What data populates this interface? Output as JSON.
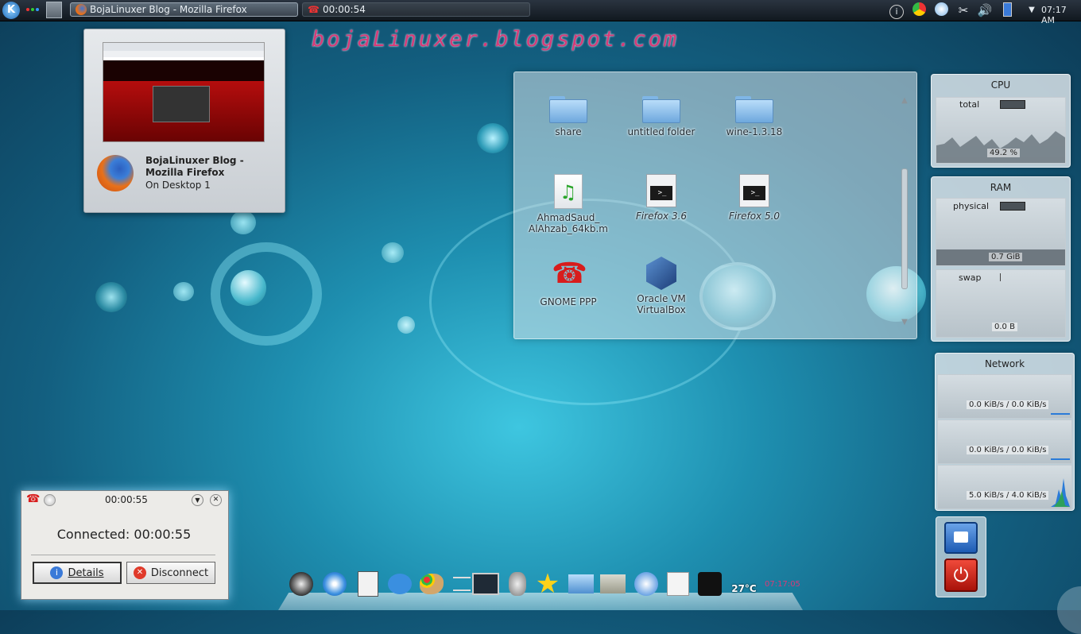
{
  "watermark": "bojaLinuxer.blogspot.com",
  "top_panel": {
    "tasks": [
      {
        "label": "BojaLinuxer Blog - Mozilla Firefox",
        "icon": "firefox-icon"
      },
      {
        "label": "00:00:54",
        "icon": "phone-icon"
      }
    ],
    "clock": "07:17 AM"
  },
  "task_preview": {
    "title": "BojaLinuxer Blog - Mozilla Firefox",
    "subtitle": "On Desktop 1"
  },
  "folder_view": {
    "items": [
      {
        "label": "share",
        "type": "folder"
      },
      {
        "label": "untitled folder",
        "type": "folder"
      },
      {
        "label": "wine-1.3.18",
        "type": "folder"
      },
      {
        "label": "AhmadSaud_ AlAhzab_64kb.m",
        "type": "audio"
      },
      {
        "label": "Firefox 3.6",
        "type": "launcher"
      },
      {
        "label": "Firefox 5.0",
        "type": "launcher"
      },
      {
        "label": "GNOME PPP",
        "type": "phone"
      },
      {
        "label": "Oracle VM VirtualBox",
        "type": "virtualbox"
      }
    ]
  },
  "cpu_widget": {
    "title": "CPU",
    "label": "total",
    "value": "49.2 %"
  },
  "ram_widget": {
    "title": "RAM",
    "physical_label": "physical",
    "physical_value": "0.7 GiB",
    "swap_label": "swap",
    "swap_value": "0.0 B"
  },
  "network_widget": {
    "title": "Network",
    "rows": [
      "0.0 KiB/s / 0.0 KiB/s",
      "0.0 KiB/s / 0.0 KiB/s",
      "5.0 KiB/s / 4.0 KiB/s"
    ]
  },
  "ppp_dialog": {
    "title": "00:00:55",
    "status": "Connected: 00:00:55",
    "details_label": "Details",
    "details_underline": "D",
    "disconnect_label": "Disconnect",
    "disconnect_underline": "D"
  },
  "dock": {
    "weather_temp": "27°C",
    "clock": "07:17:05"
  },
  "colors": {
    "accent_pink": "#c8306a",
    "panel_bg": "#1a222a"
  }
}
